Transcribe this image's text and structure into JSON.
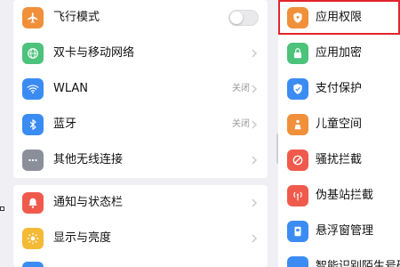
{
  "settings_list": {
    "group1": [
      {
        "label": "飞行模式",
        "icon": "airplane-icon",
        "color": "#f0903a",
        "control": "toggle",
        "toggle_on": false
      },
      {
        "label": "双卡与移动网络",
        "icon": "globe-icon",
        "color": "#4cc27b",
        "control": "chevron"
      },
      {
        "label": "WLAN",
        "icon": "wifi-icon",
        "color": "#3b8cf2",
        "control": "chevron",
        "value": "关闭"
      },
      {
        "label": "蓝牙",
        "icon": "bluetooth-icon",
        "color": "#3b8cf2",
        "control": "chevron",
        "value": "关闭"
      },
      {
        "label": "其他无线连接",
        "icon": "more-icon",
        "color": "#8a8f9a",
        "control": "chevron"
      }
    ],
    "group2": [
      {
        "label": "通知与状态栏",
        "icon": "bell-icon",
        "color": "#f05a4c"
      },
      {
        "label": "显示与亮度",
        "icon": "sun-icon",
        "color": "#f4b935"
      }
    ]
  },
  "privacy_list": {
    "items": [
      {
        "label": "应用权限",
        "icon": "shield-icon",
        "color": "#f0903a",
        "highlighted": true
      },
      {
        "label": "应用加密",
        "icon": "lock-icon",
        "color": "#4cc27b"
      },
      {
        "label": "支付保护",
        "icon": "shield-check-icon",
        "color": "#3b8cf2"
      },
      {
        "label": "儿童空间",
        "icon": "child-icon",
        "color": "#f0903a"
      },
      {
        "label": "骚扰拦截",
        "icon": "block-icon",
        "color": "#f05a4c"
      },
      {
        "label": "伪基站拦截",
        "icon": "antenna-icon",
        "color": "#f05a4c"
      },
      {
        "label": "悬浮窗管理",
        "icon": "floating-window-icon",
        "color": "#3b8cf2"
      },
      {
        "label": "智能识别陌生号码",
        "icon": "id-icon",
        "color": "#3b8cf2"
      }
    ]
  }
}
